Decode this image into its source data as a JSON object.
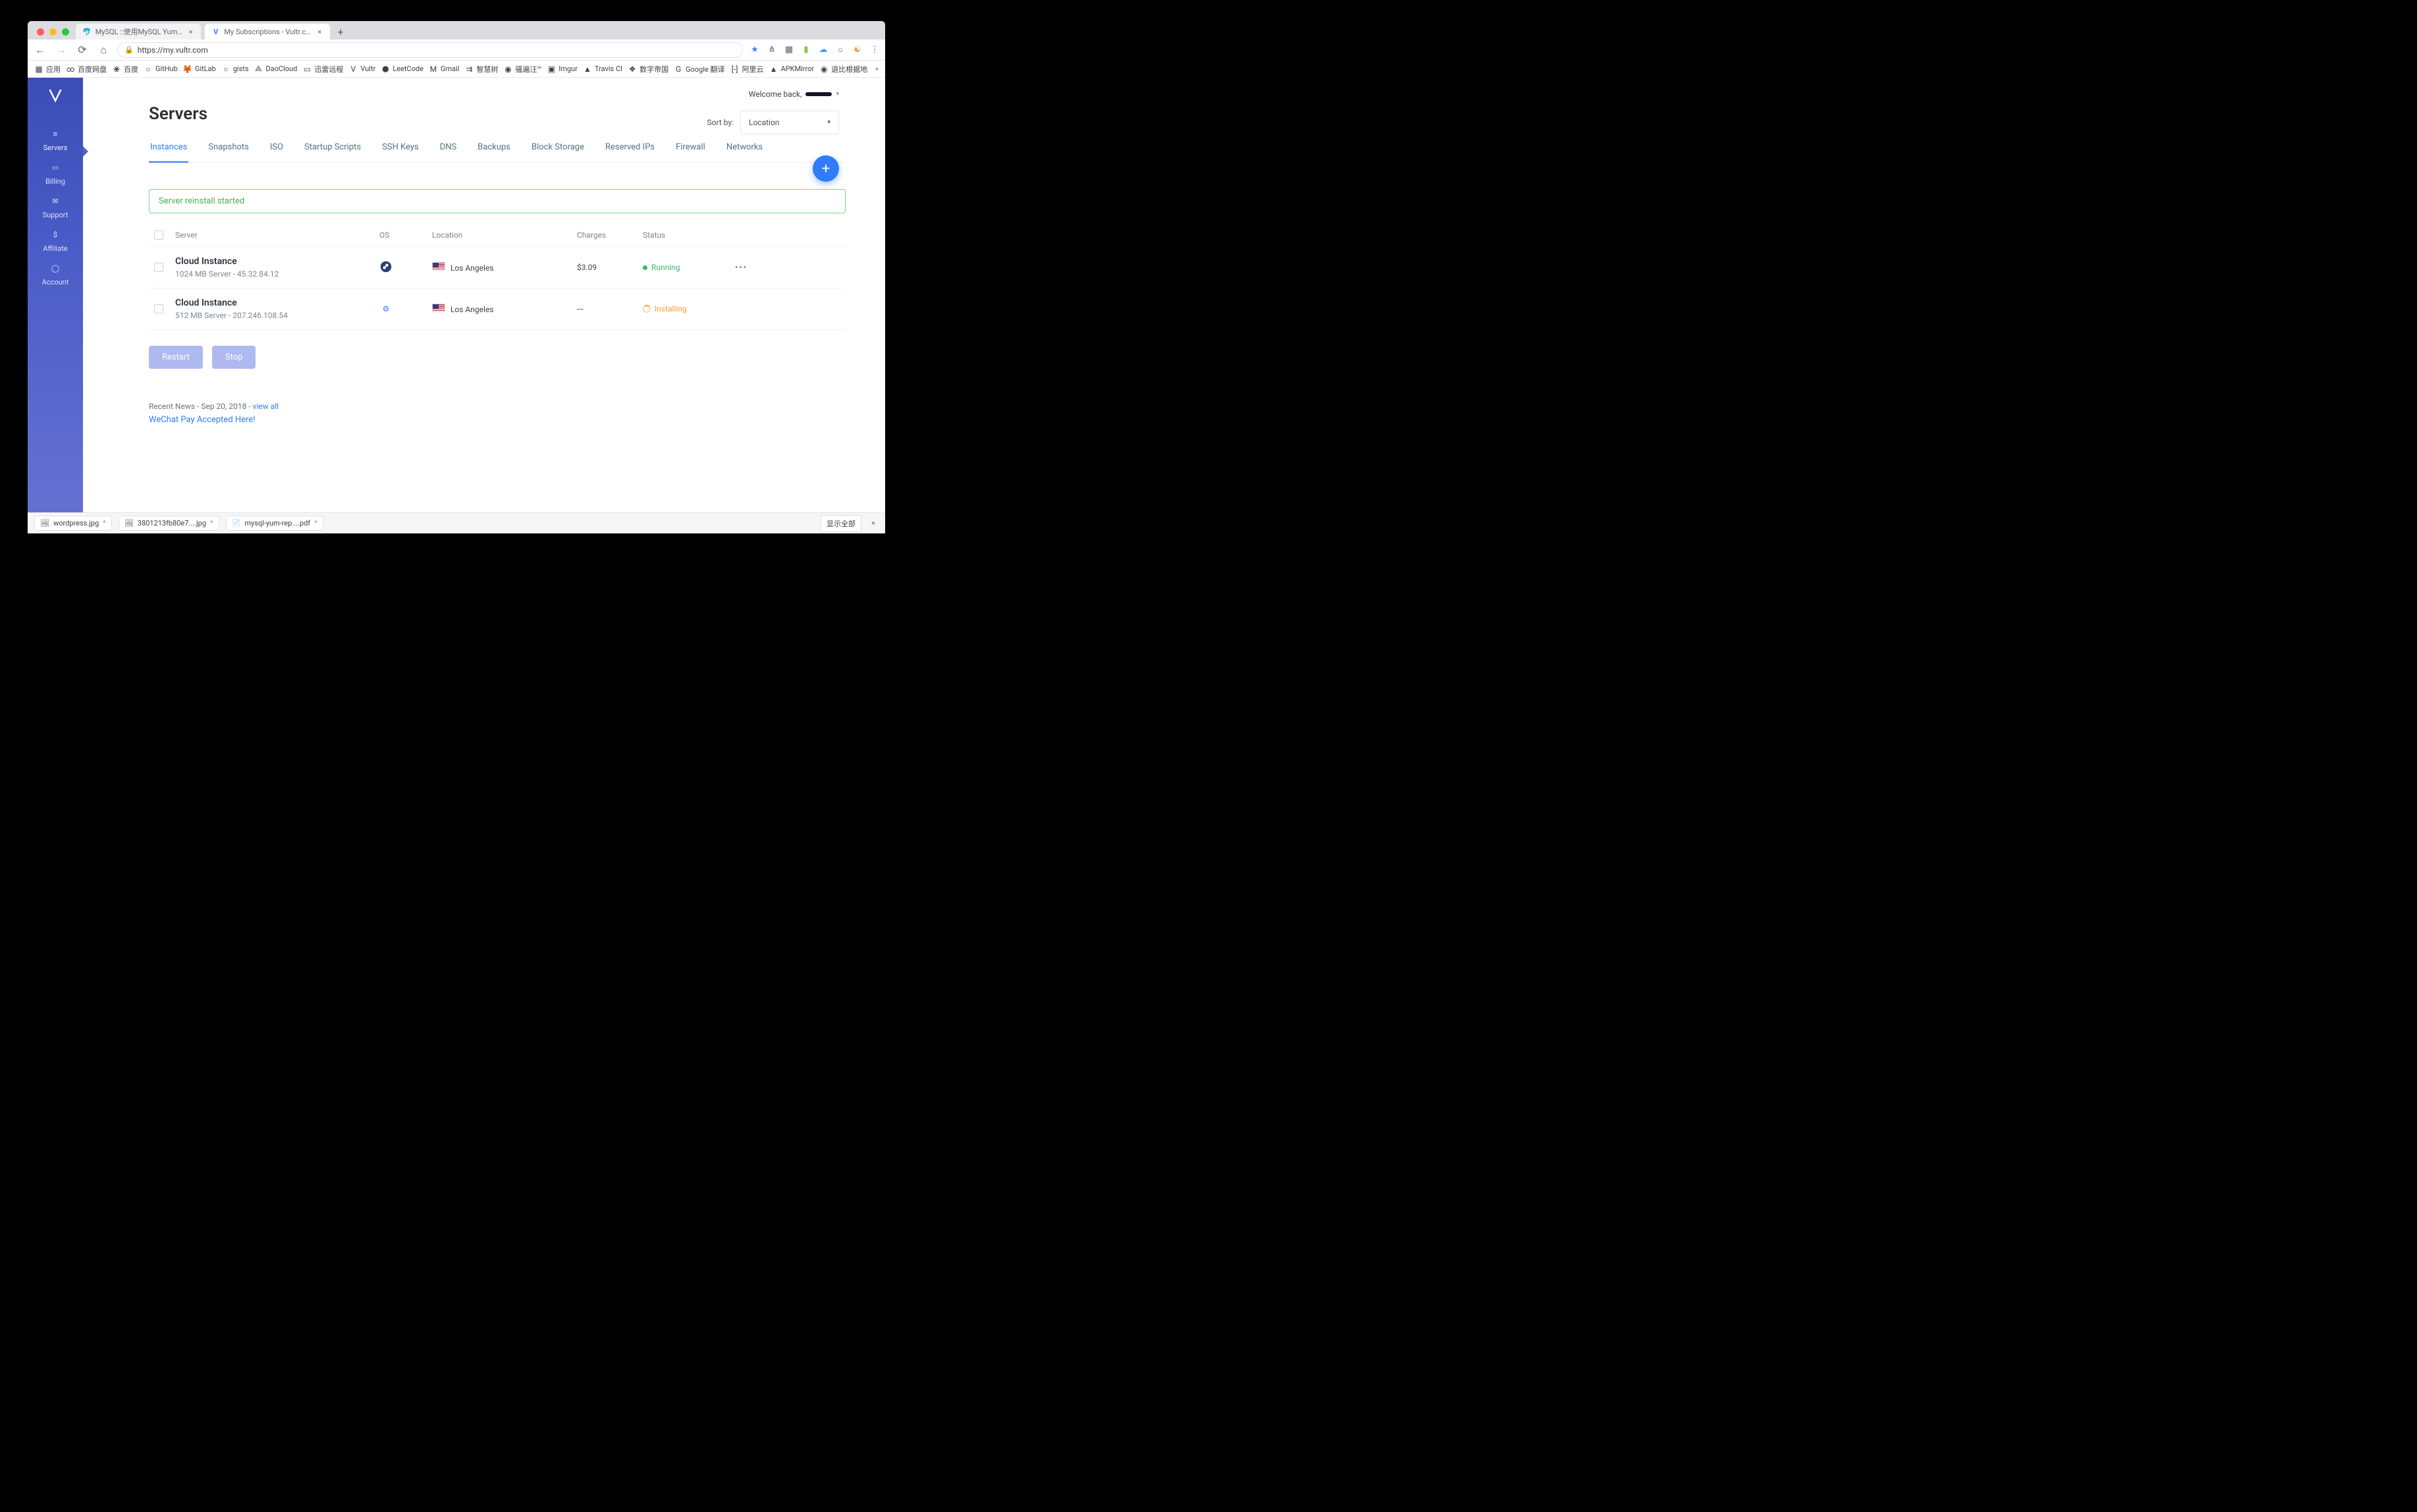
{
  "browser": {
    "tabs": [
      {
        "title": "MySQL ::使用MySQL Yum存储",
        "favicon": "🐬"
      },
      {
        "title": "My Subscriptions - Vultr.com",
        "favicon": "V"
      }
    ],
    "url": "https://my.vultr.com",
    "ext_icons": [
      "★",
      "⋔",
      "▦",
      "▮",
      "☁",
      "○",
      "☯"
    ],
    "menu": "⋮"
  },
  "bookmarks": [
    {
      "ico": "▦",
      "label": "应用"
    },
    {
      "ico": "∞",
      "label": "百度网盘"
    },
    {
      "ico": "❀",
      "label": "百度"
    },
    {
      "ico": "○",
      "label": "GitHub"
    },
    {
      "ico": "🦊",
      "label": "GitLab"
    },
    {
      "ico": "○",
      "label": "gists"
    },
    {
      "ico": "⟁",
      "label": "DaoCloud"
    },
    {
      "ico": "▭",
      "label": "迅雷远程"
    },
    {
      "ico": "V",
      "label": "Vultr"
    },
    {
      "ico": "⬢",
      "label": "LeetCode"
    },
    {
      "ico": "M",
      "label": "Gmail"
    },
    {
      "ico": "⇉",
      "label": "智慧树"
    },
    {
      "ico": "◉",
      "label": "骚遍汪™"
    },
    {
      "ico": "▣",
      "label": "Imgur"
    },
    {
      "ico": "▲",
      "label": "Travis CI"
    },
    {
      "ico": "❖",
      "label": "数字帝国"
    },
    {
      "ico": "G",
      "label": "Google 翻译"
    },
    {
      "ico": "[-]",
      "label": "阿里云"
    },
    {
      "ico": "▲",
      "label": "APKMirror"
    },
    {
      "ico": "◉",
      "label": "退比根据地"
    }
  ],
  "sidebar": [
    {
      "icon": "≡",
      "label": "Servers"
    },
    {
      "icon": "▭",
      "label": "Billing"
    },
    {
      "icon": "✉",
      "label": "Support"
    },
    {
      "icon": "$",
      "label": "Affiliate"
    },
    {
      "icon": "◯",
      "label": "Account"
    }
  ],
  "welcome_prefix": "Welcome back,",
  "page_title": "Servers",
  "sort_label": "Sort by:",
  "sort_value": "Location",
  "nav_tabs": [
    "Instances",
    "Snapshots",
    "ISO",
    "Startup Scripts",
    "SSH Keys",
    "DNS",
    "Backups",
    "Block Storage",
    "Reserved IPs",
    "Firewall",
    "Networks"
  ],
  "alert_text": "Server reinstall started",
  "table": {
    "headers": {
      "server": "Server",
      "os": "OS",
      "location": "Location",
      "charges": "Charges",
      "status": "Status"
    },
    "rows": [
      {
        "name": "Cloud Instance",
        "sub": "1024 MB Server - 45.32.84.12",
        "os_icon": "fedora",
        "location": "Los Angeles",
        "charges": "$3.09",
        "status": "Running",
        "status_kind": "run",
        "actions": "•••"
      },
      {
        "name": "Cloud Instance",
        "sub": "512 MB Server - 207.246.108.54",
        "os_icon": "gear",
        "location": "Los Angeles",
        "charges": "---",
        "status": "Installing",
        "status_kind": "inst",
        "actions": ""
      }
    ]
  },
  "buttons": {
    "restart": "Restart",
    "stop": "Stop"
  },
  "news": {
    "prefix": "Recent News - Sep 20, 2018 - ",
    "viewall": "view all",
    "item": "WeChat Pay Accepted Here!"
  },
  "downloads": [
    {
      "ico": "🖼",
      "name": "wordpress.jpg"
    },
    {
      "ico": "🖼",
      "name": "3801213fb80e7....jpg"
    },
    {
      "ico": "📄",
      "name": "mysql-yum-rep....pdf"
    }
  ],
  "downloads_showall": "显示全部"
}
